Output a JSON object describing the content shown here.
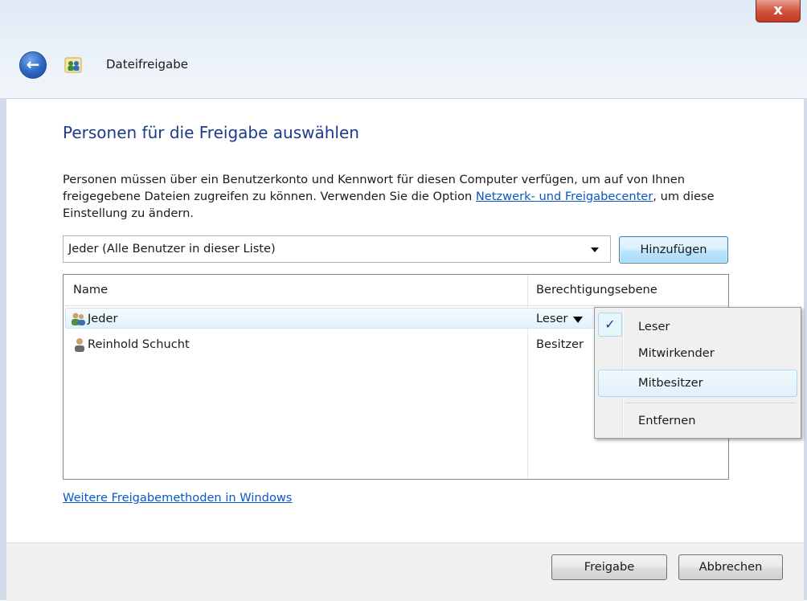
{
  "window": {
    "title": "Dateifreigabe",
    "close_label": "x",
    "back_icon": "back-arrow-icon"
  },
  "main": {
    "heading": "Personen für die Freigabe auswählen",
    "description_before_link": "Personen müssen über ein Benutzerkonto und Kennwort für diesen Computer verfügen, um auf von Ihnen freigegebene Dateien zugreifen zu können. Verwenden Sie die Option ",
    "description_link": "Netzwerk- und Freigabecenter",
    "description_after_link": ", um diese Einstellung zu ändern.",
    "combo_value": "Jeder (Alle Benutzer in dieser Liste)",
    "add_button": "Hinzufügen",
    "more_link": "Weitere Freigabemethoden in Windows"
  },
  "list": {
    "columns": [
      "Name",
      "Berechtigungsebene"
    ],
    "rows": [
      {
        "name": "Jeder",
        "permission": "Leser",
        "icon": "group-users-icon",
        "selected": true
      },
      {
        "name": "Reinhold Schucht",
        "permission": "Besitzer",
        "icon": "user-icon",
        "selected": false
      }
    ]
  },
  "permission_menu": {
    "items": [
      "Leser",
      "Mitwirkender",
      "Mitbesitzer",
      "Entfernen"
    ],
    "checked": "Leser",
    "hovered": "Mitbesitzer",
    "check_mark": "✓"
  },
  "footer": {
    "share_button": "Freigabe",
    "cancel_button": "Abbrechen"
  }
}
